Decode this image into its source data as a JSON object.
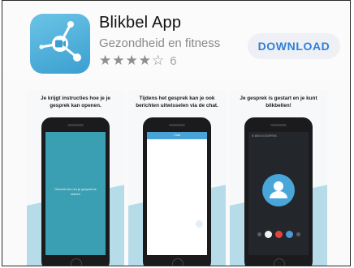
{
  "app": {
    "name": "Blikbel App",
    "category": "Gezondheid en fitness",
    "rating_value": 4,
    "rating_max": 5,
    "rating_count": "6",
    "download_label": "DOWNLOAD",
    "accent_color": "#2f80d6",
    "icon_colors": [
      "#6cc4e6",
      "#3a9fd0"
    ]
  },
  "screenshots": [
    {
      "caption": "Je krijgt instructies hoe je je gesprek kan openen.",
      "screen_text": "Gebruik link om je gesprek te starten"
    },
    {
      "caption": "Tijdens het gesprek kan je ook berichten uitwisselen via de chat.",
      "screen_text": "Chat"
    },
    {
      "caption": "Je gesprek is gestart en je kunt blikbellen!",
      "screen_text": "IK BEN IN GESPREK"
    }
  ]
}
